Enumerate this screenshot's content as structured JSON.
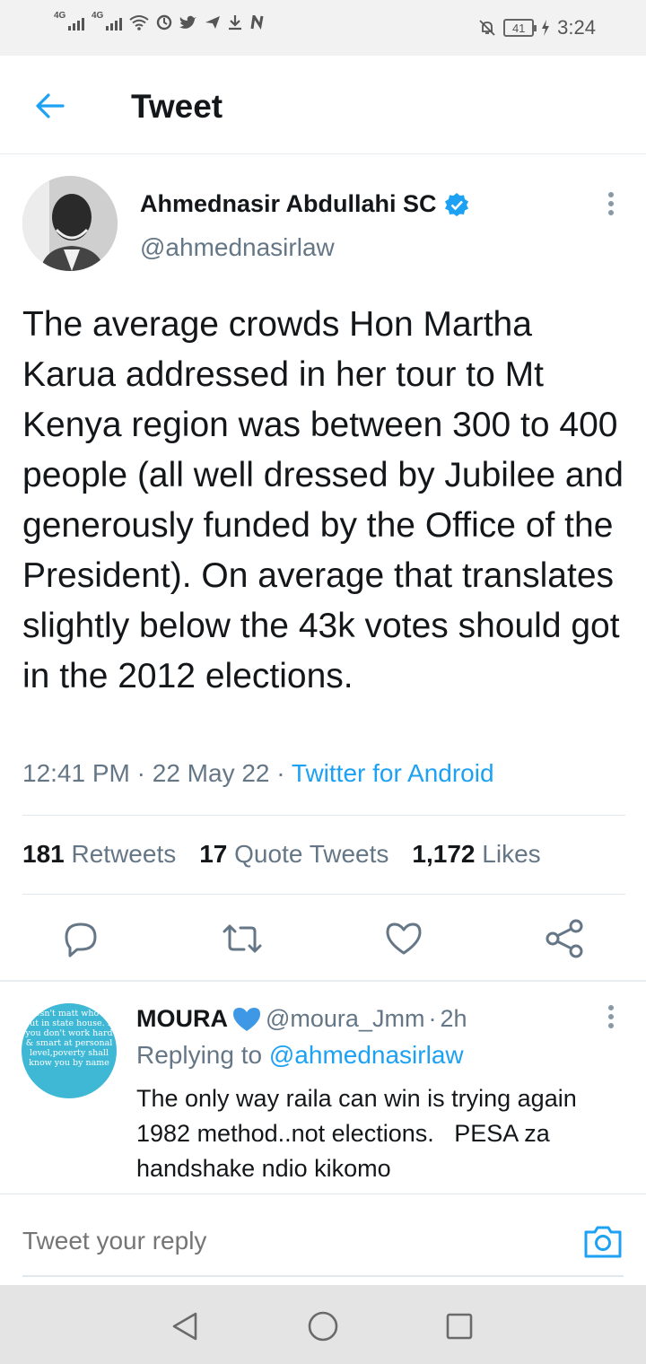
{
  "status_bar": {
    "signal1_label": "4G",
    "signal2_label": "4G",
    "battery": "41",
    "time": "3:24",
    "icons": [
      "wifi-icon",
      "sync-icon",
      "twitter-icon",
      "send-icon",
      "download-icon",
      "n-icon",
      "mute-icon",
      "charging-icon"
    ]
  },
  "header": {
    "title": "Tweet"
  },
  "tweet": {
    "author_name": "Ahmednasir Abdullahi SC",
    "handle": "@ahmednasirlaw",
    "text": "The average crowds Hon Martha Karua addressed in her tour to Mt Kenya region was between 300 to 400 people (all well dressed by Jubilee and generously funded by the Office of the President). On average that translates slightly below the 43k votes should got in the 2012 elections.",
    "time": "12:41 PM",
    "date": "22 May 22",
    "source": "Twitter for Android",
    "retweets_count": "181",
    "retweets_label": "Retweets",
    "quotes_count": "17",
    "quotes_label": "Quote Tweets",
    "likes_count": "1,172",
    "likes_label": "Likes"
  },
  "reply": {
    "name": "MOURA",
    "handle": "@moura_Jmm",
    "time": "2h",
    "replying_prefix": "Replying to",
    "replying_to": "@ahmednasirlaw",
    "text": "The only way raila can win is trying again 1982 method..not elections.   PESA za handshake ndio kikomo",
    "avatar_text": "doesn't matt who we put in state house. If you don't work hard & smart at personal level,poverty shall know you by name"
  },
  "composer": {
    "placeholder": "Tweet your reply"
  },
  "colors": {
    "accent": "#1da1f2",
    "secondary_text": "#657786",
    "primary_text": "#14171a"
  }
}
